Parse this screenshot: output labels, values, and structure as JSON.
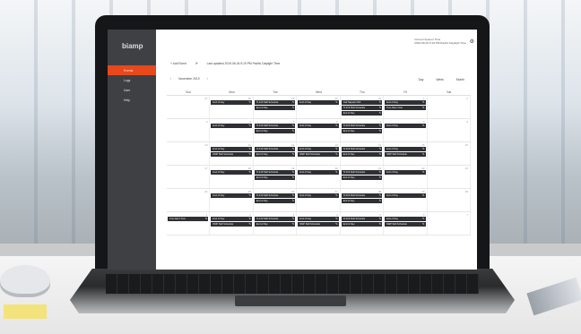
{
  "app": {
    "logo": "biamp"
  },
  "sidebar": {
    "items": [
      {
        "label": "Events",
        "active": true
      },
      {
        "label": "Logs"
      },
      {
        "label": "User"
      },
      {
        "label": "Help"
      }
    ]
  },
  "header": {
    "system_time_label": "Current System Time",
    "system_time_value": "2019-06-04 5:19 PM Pacific Daylight Time"
  },
  "toolbar": {
    "add_event": "+ Add Event",
    "last_updated": "Last updated 2019-06-04 5:19 PM Pacific Daylight Time"
  },
  "calendar": {
    "month_label": "November 2019",
    "views": [
      "Day",
      "Week",
      "Month"
    ],
    "weekdays": [
      "Sun",
      "Mon",
      "Tue",
      "Wed",
      "Thu",
      "Fri",
      "Sat"
    ],
    "weeks": [
      [
        {
          "n": "27",
          "ev": []
        },
        {
          "n": "28",
          "ev": [
            "End of Day"
          ]
        },
        {
          "n": "29",
          "ev": [
            "TLF19 Skill Schedule",
            "End of Day"
          ]
        },
        {
          "n": "30",
          "ev": [
            "End of Day"
          ]
        },
        {
          "n": "31",
          "ev": [
            "Call Napster Drill",
            "TLF19 Skill Schedule",
            "End of Day"
          ]
        },
        {
          "n": "1",
          "ev": [
            "End of Day",
            "One Alarm Test"
          ]
        },
        {
          "n": "2",
          "ev": []
        }
      ],
      [
        {
          "n": "3",
          "ev": []
        },
        {
          "n": "4",
          "ev": [
            "End of Day"
          ]
        },
        {
          "n": "5",
          "ev": [
            "TLF19 Skill Schedule",
            "End of Day"
          ]
        },
        {
          "n": "6",
          "ev": [
            "End of Day"
          ]
        },
        {
          "n": "7",
          "ev": [
            "TLF19 Skill Schedule",
            "End of Day"
          ]
        },
        {
          "n": "8",
          "ev": [
            "End of Day"
          ]
        },
        {
          "n": "9",
          "ev": []
        }
      ],
      [
        {
          "n": "10",
          "ev": []
        },
        {
          "n": "11",
          "ev": [
            "End of Day",
            "NMP Skill Schedule"
          ]
        },
        {
          "n": "12",
          "ev": [
            "TLF19 Skill Schedule",
            "End of Day"
          ]
        },
        {
          "n": "13",
          "ev": [
            "End of Day",
            "NMP Skill Schedule"
          ]
        },
        {
          "n": "14",
          "ev": [
            "TLF19 Skill Schedule",
            "End of Day"
          ]
        },
        {
          "n": "15",
          "ev": [
            "End of Day",
            "NMP Skill Schedule"
          ]
        },
        {
          "n": "16",
          "ev": []
        }
      ],
      [
        {
          "n": "17",
          "ev": []
        },
        {
          "n": "18",
          "ev": [
            "End of Day"
          ]
        },
        {
          "n": "19",
          "ev": [
            "TLF19 Skill Schedule",
            "End of Day"
          ]
        },
        {
          "n": "20",
          "ev": [
            "End of Day"
          ]
        },
        {
          "n": "21",
          "ev": [
            "TLF19 Skill Schedule",
            "End of Day"
          ]
        },
        {
          "n": "22",
          "ev": [
            "End of Day"
          ]
        },
        {
          "n": "23",
          "ev": []
        }
      ],
      [
        {
          "n": "24",
          "ev": []
        },
        {
          "n": "25",
          "ev": [
            "End of Day"
          ]
        },
        {
          "n": "26",
          "ev": [
            "TLF19 Skill Schedule",
            "End of Day"
          ]
        },
        {
          "n": "27",
          "ev": [
            "End of Day"
          ]
        },
        {
          "n": "28",
          "ev": [
            "TLF19 Skill Schedule",
            "End of Day"
          ]
        },
        {
          "n": "29",
          "ev": [
            "End of Day"
          ]
        },
        {
          "n": "30",
          "ev": []
        }
      ],
      [
        {
          "n": "1",
          "ev": [
            "One Alarm Test"
          ]
        },
        {
          "n": "2",
          "ev": [
            "End of Day",
            "NMP Skill Schedule"
          ]
        },
        {
          "n": "3",
          "ev": [
            "TLF19 Skill Schedule",
            "End of Day"
          ]
        },
        {
          "n": "4",
          "ev": [
            "End of Day",
            "NMP Skill Schedule"
          ]
        },
        {
          "n": "5",
          "ev": [
            "TLF19 Skill Schedule",
            "End of Day"
          ]
        },
        {
          "n": "6",
          "ev": [
            "End of Day",
            "NMP Skill Schedule"
          ]
        },
        {
          "n": "7",
          "ev": []
        }
      ]
    ]
  }
}
